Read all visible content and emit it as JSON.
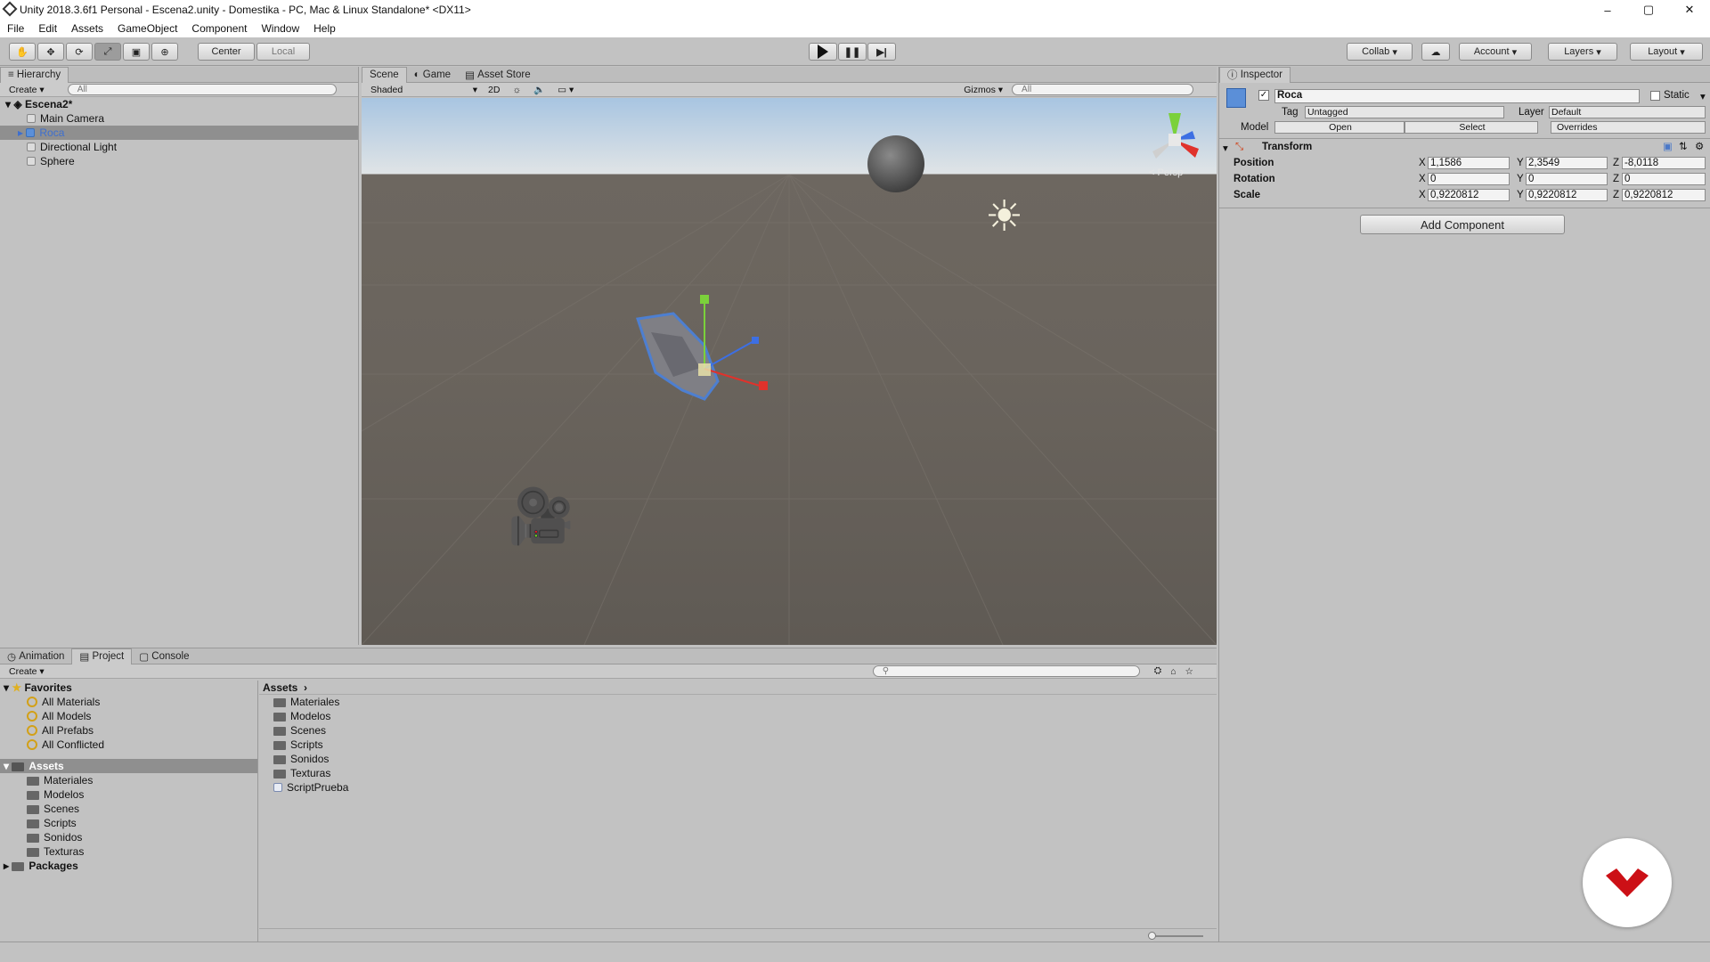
{
  "window": {
    "title": "Unity 2018.3.6f1 Personal - Escena2.unity - Domestika - PC, Mac & Linux Standalone* <DX11>",
    "minimize": "–",
    "maximize": "▢",
    "close": "✕"
  },
  "menu": [
    "File",
    "Edit",
    "Assets",
    "GameObject",
    "Component",
    "Window",
    "Help"
  ],
  "toolbar": {
    "tools": [
      "hand-icon",
      "move-icon",
      "rotate-icon",
      "scale-icon",
      "rect-icon",
      "transform-icon"
    ],
    "pivot": "Center",
    "space": "Local",
    "collab": "Collab",
    "account": "Account",
    "layers": "Layers",
    "layout": "Layout"
  },
  "hierarchy": {
    "tab": "Hierarchy",
    "create": "Create",
    "search": "All",
    "scene": "Escena2*",
    "items": [
      "Main Camera",
      "Roca",
      "Directional Light",
      "Sphere"
    ],
    "selected": "Roca"
  },
  "scene": {
    "tabs": [
      "Scene",
      "Game",
      "Asset Store"
    ],
    "shading": "Shaded",
    "mode2d": "2D",
    "gizmos": "Gizmos",
    "search": "All",
    "persp": "Persp"
  },
  "inspector": {
    "tab": "Inspector",
    "name": "Roca",
    "static": "Static",
    "tag_label": "Tag",
    "tag": "Untagged",
    "layer_label": "Layer",
    "layer": "Default",
    "model_label": "Model",
    "open": "Open",
    "select": "Select",
    "overrides": "Overrides",
    "transform": "Transform",
    "position_label": "Position",
    "rotation_label": "Rotation",
    "scale_label": "Scale",
    "position": {
      "x": "1,1586",
      "y": "2,3549",
      "z": "-8,0118"
    },
    "rotation": {
      "x": "0",
      "y": "0",
      "z": "0"
    },
    "scale": {
      "x": "0,9220812",
      "y": "0,9220812",
      "z": "0,9220812"
    },
    "add_component": "Add Component",
    "axis": {
      "x": "X",
      "y": "Y",
      "z": "Z"
    }
  },
  "bottom": {
    "tabs": [
      "Animation",
      "Project",
      "Console"
    ],
    "create": "Create",
    "favorites": "Favorites",
    "fav_items": [
      "All Materials",
      "All Models",
      "All Prefabs",
      "All Conflicted"
    ],
    "assets": "Assets",
    "asset_folders": [
      "Materiales",
      "Modelos",
      "Scenes",
      "Scripts",
      "Sonidos",
      "Texturas"
    ],
    "packages": "Packages",
    "breadcrumb": "Assets",
    "grid_items": [
      "Materiales",
      "Modelos",
      "Scenes",
      "Scripts",
      "Sonidos",
      "Texturas",
      "ScriptPrueba"
    ]
  },
  "colors": {
    "brand": "#cc1016",
    "sky_top": "#a5c4e0",
    "ground": "#5f5a54"
  }
}
